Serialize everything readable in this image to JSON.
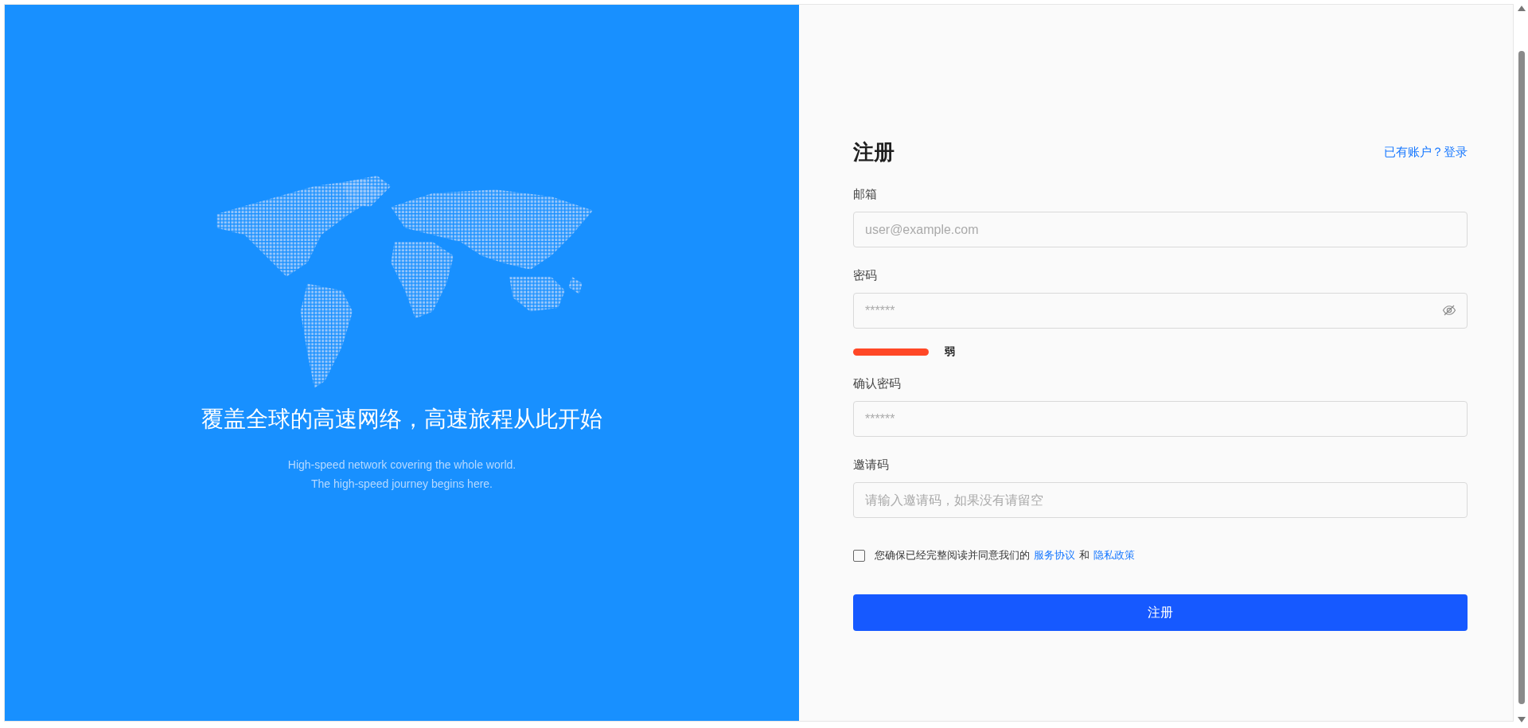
{
  "hero": {
    "heading": "覆盖全球的高速网络，高速旅程从此开始",
    "subtitle_lines": [
      "High-speed network covering the whole world.",
      "The high-speed journey begins here."
    ]
  },
  "form": {
    "title": "注册",
    "login_link": {
      "prompt": "已有账户？",
      "action": "登录"
    },
    "fields": [
      {
        "kind": "text",
        "label": "邮箱",
        "placeholder": "user@example.com"
      },
      {
        "kind": "password",
        "label": "密码",
        "placeholder": "******",
        "strength": {
          "label": "弱"
        }
      },
      {
        "kind": "plain-password",
        "label": "确认密码",
        "placeholder": "******"
      },
      {
        "kind": "text",
        "label": "邀请码",
        "placeholder": "请输入邀请码，如果没有请留空"
      }
    ],
    "agreement": {
      "checked": false,
      "text": "您确保已经完整阅读并同意我们的",
      "terms_link": "服务协议",
      "conjunction": "和",
      "privacy_link": "隐私政策"
    },
    "submit": "注册"
  }
}
